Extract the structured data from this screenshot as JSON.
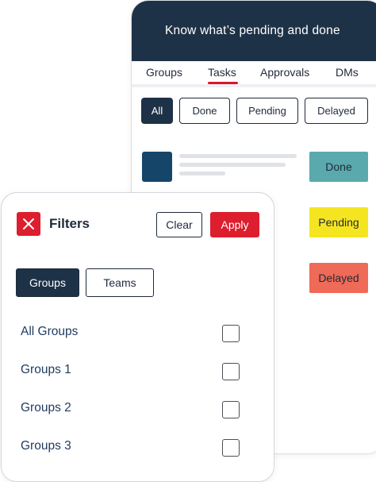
{
  "back_card": {
    "header_title": "Know what’s pending and done",
    "tabs": [
      {
        "label": "Groups",
        "active": false
      },
      {
        "label": "Tasks",
        "active": true
      },
      {
        "label": "Approvals",
        "active": false
      },
      {
        "label": "DMs",
        "active": false
      }
    ],
    "status_filters": [
      {
        "label": "All",
        "active": true
      },
      {
        "label": "Done",
        "active": false
      },
      {
        "label": "Pending",
        "active": false
      },
      {
        "label": "Delayed",
        "active": false
      }
    ],
    "statuses": [
      {
        "label": "Done",
        "color": "#5aa9ad"
      },
      {
        "label": "Pending",
        "color": "#f5e520"
      },
      {
        "label": "Delayed",
        "color": "#ef6a57"
      }
    ],
    "accent_color": "#d9172b",
    "header_color": "#1e3247"
  },
  "filter_panel": {
    "title": "Filters",
    "close_icon": "close-icon",
    "clear_label": "Clear",
    "apply_label": "Apply",
    "segments": [
      {
        "label": "Groups",
        "active": true
      },
      {
        "label": "Teams",
        "active": false
      }
    ],
    "options": [
      {
        "label": "All Groups",
        "checked": false
      },
      {
        "label": "Groups 1",
        "checked": false
      },
      {
        "label": "Groups 2",
        "checked": false
      },
      {
        "label": "Groups 3",
        "checked": false
      }
    ],
    "apply_color": "#dc1e2e"
  }
}
